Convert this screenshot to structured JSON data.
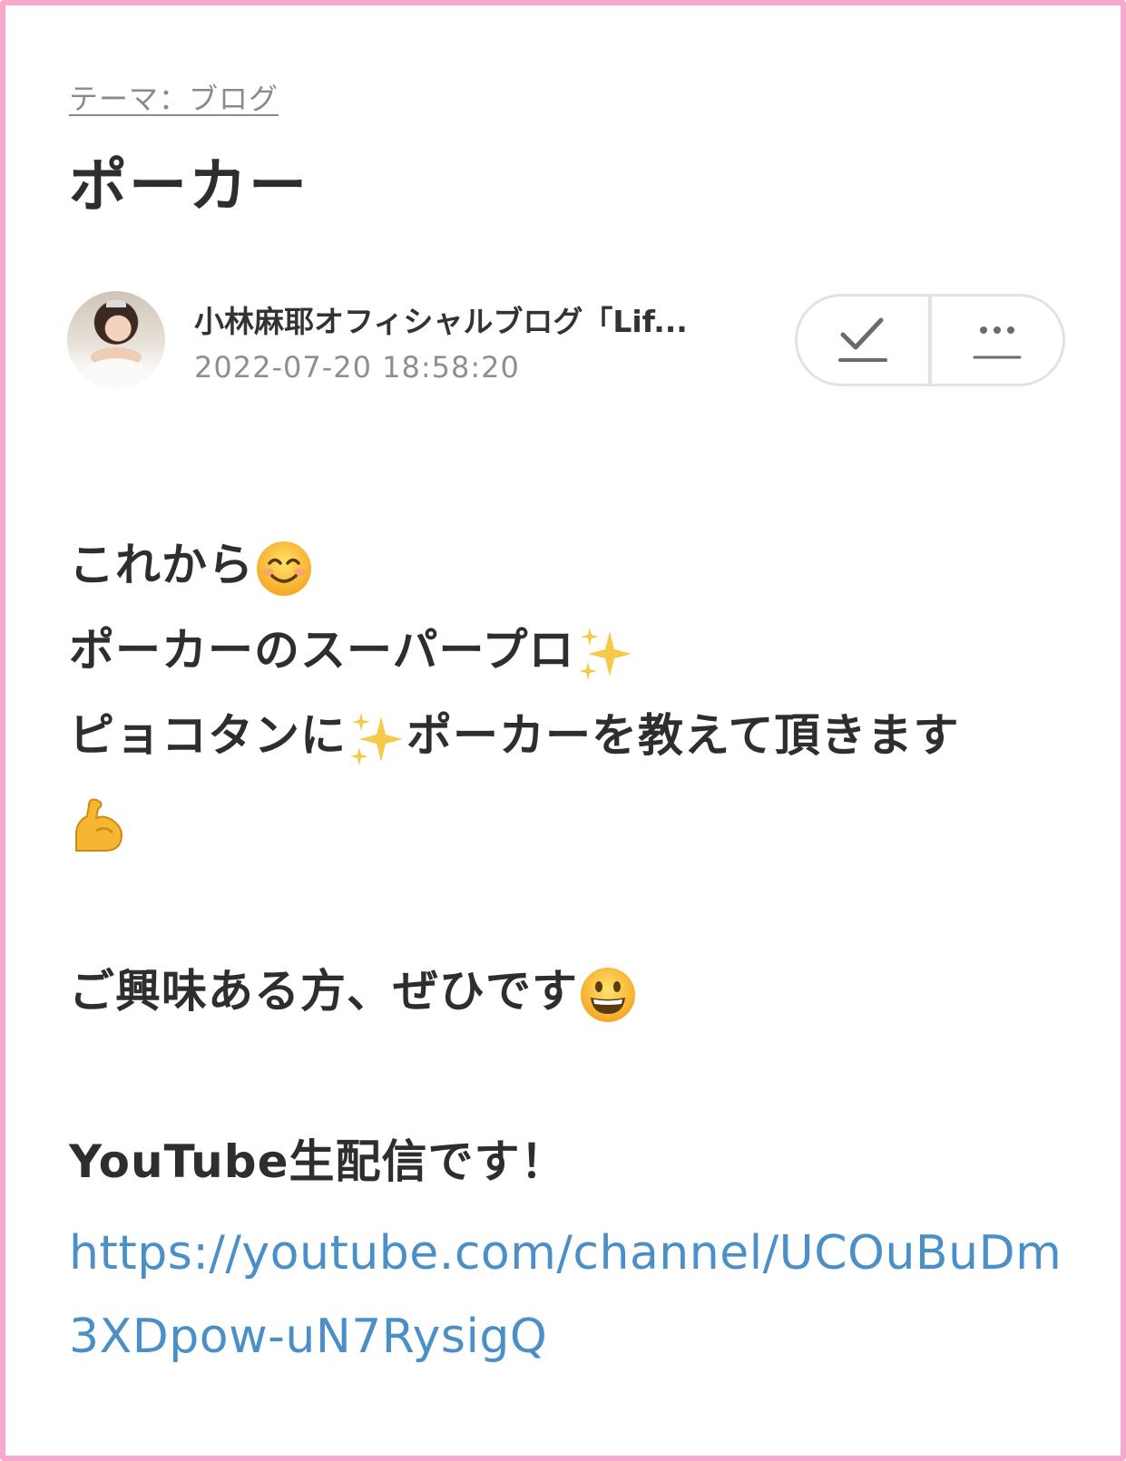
{
  "post": {
    "theme": "テーマ：ブログ",
    "title": "ポーカー",
    "author": "小林麻耶オフィシャルブログ「Lif...",
    "timestamp": "2022-07-20 18:58:20"
  },
  "icons": {
    "check": "check-icon",
    "more": "more-icon",
    "smile": "smiling-face-emoji",
    "sparkles": "sparkles-emoji",
    "muscle": "flexed-biceps-emoji",
    "grin": "grinning-face-emoji"
  },
  "content": {
    "line1": "これから",
    "line2": "ポーカーのスーパープロ",
    "line3a": "ピョコタンに",
    "line3b": "ポーカーを教えて頂きます",
    "line5": "ご興味ある方、ぜひです",
    "line7": "YouTube生配信です！",
    "link": "https://youtube.com/channel/UCOuBuDm3XDpow-uN7RysigQ"
  },
  "colors": {
    "frame": "#f7a8cc",
    "link": "#4a8fc7",
    "text": "#2e2e2e",
    "muted": "#8f8f8f"
  }
}
